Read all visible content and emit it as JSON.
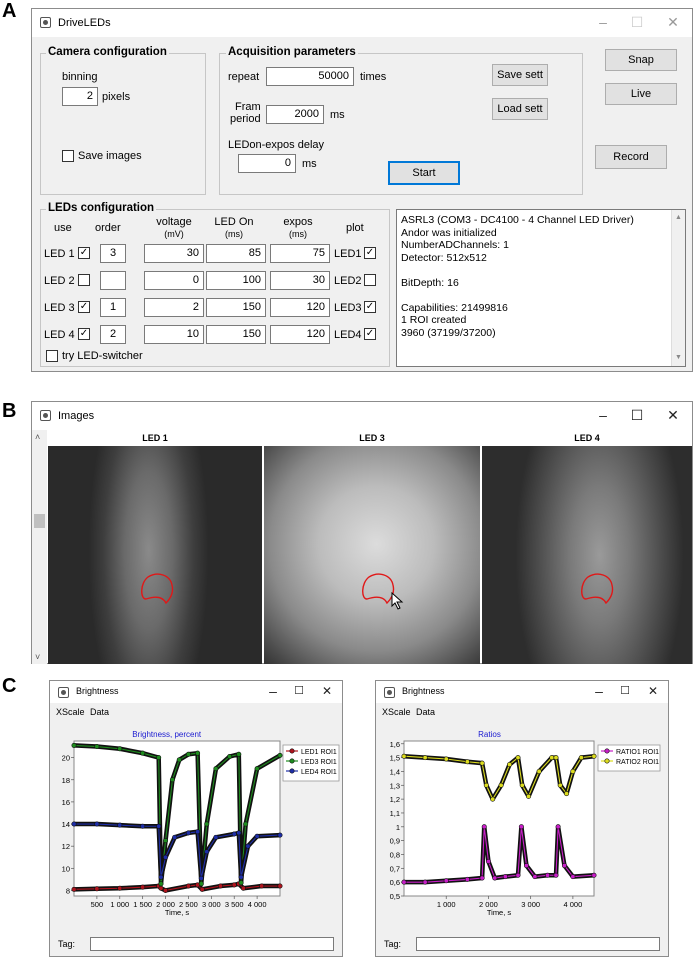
{
  "panels": {
    "a": "A",
    "b": "B",
    "c": "C"
  },
  "drive": {
    "title": "DriveLEDs",
    "camera": {
      "title": "Camera configuration",
      "binning_label": "binning",
      "binning_value": "2",
      "binning_unit": "pixels",
      "save_images": "Save images"
    },
    "acq": {
      "title": "Acquisition parameters",
      "repeat_label": "repeat",
      "repeat_value": "50000",
      "repeat_unit": "times",
      "fram_label1": "Fram",
      "fram_label2": "period",
      "fram_value": "2000",
      "fram_unit": "ms",
      "delay_label": "LEDon-expos delay",
      "delay_value": "0",
      "delay_unit": "ms",
      "save_sett": "Save sett",
      "load_sett": "Load sett",
      "start": "Start"
    },
    "side": {
      "snap": "Snap",
      "live": "Live",
      "record": "Record"
    },
    "leds": {
      "title": "LEDs configuration",
      "headers": {
        "use": "use",
        "order": "order",
        "voltage": "voltage",
        "voltage_unit": "(mV)",
        "ledon": "LED On",
        "ledon_unit": "(ms)",
        "expos": "expos",
        "expos_unit": "(ms)",
        "plot": "plot"
      },
      "rows": [
        {
          "name": "LED 1",
          "use": "✓",
          "order": "3",
          "voltage": "30",
          "ledon": "85",
          "expos": "75",
          "plot_name": "LED1",
          "plot": "✓"
        },
        {
          "name": "LED 2",
          "use": "",
          "order": "",
          "voltage": "0",
          "ledon": "100",
          "expos": "30",
          "plot_name": "LED2",
          "plot": ""
        },
        {
          "name": "LED 3",
          "use": "✓",
          "order": "1",
          "voltage": "2",
          "ledon": "150",
          "expos": "120",
          "plot_name": "LED3",
          "plot": "✓"
        },
        {
          "name": "LED 4",
          "use": "✓",
          "order": "2",
          "voltage": "10",
          "ledon": "150",
          "expos": "120",
          "plot_name": "LED4",
          "plot": "✓"
        }
      ],
      "try_switcher": "try LED-switcher"
    },
    "info_lines": [
      "ASRL3 (COM3 - DC4100 - 4 Channel LED Driver)",
      "Andor was initialized",
      "NumberADChannels: 1",
      "Detector: 512x512",
      "",
      "BitDepth: 16",
      "",
      "Capabilities: 21499816",
      "1 ROI created",
      "3960 (37199/37200)"
    ]
  },
  "images": {
    "title": "Images",
    "tiles": [
      {
        "label": "LED 1"
      },
      {
        "label": "LED 3"
      },
      {
        "label": "LED 4"
      }
    ]
  },
  "brightness_left": {
    "title": "Brightness",
    "menu": [
      "XScale",
      "Data"
    ],
    "tag_label": "Tag:",
    "chart_data": {
      "type": "line",
      "title": "Brightness, percent",
      "xlabel": "Time, s",
      "ylabel": "",
      "xlim": [
        0,
        4500
      ],
      "ylim": [
        7.5,
        21.5
      ],
      "xticks": [
        500,
        1000,
        1500,
        2000,
        2500,
        3000,
        3500,
        4000
      ],
      "xtick_labels": [
        "500",
        "1 000",
        "1 500",
        "2 000",
        "2 500",
        "3 000",
        "3 500",
        "4 000"
      ],
      "yticks": [
        8,
        10,
        12,
        14,
        16,
        18,
        20
      ],
      "legend_position": "top-right",
      "series": [
        {
          "name": "LED1 ROI1",
          "color": "#b0141e",
          "x": [
            0,
            500,
            1000,
            1500,
            1850,
            1900,
            2000,
            2500,
            2700,
            2800,
            3200,
            3500,
            3600,
            3700,
            4100,
            4500
          ],
          "y": [
            8.1,
            8.15,
            8.2,
            8.3,
            8.4,
            8.2,
            8.0,
            8.4,
            8.5,
            8.1,
            8.4,
            8.5,
            8.6,
            8.2,
            8.4,
            8.4
          ]
        },
        {
          "name": "LED3 ROI1",
          "color": "#1e8c1e",
          "x": [
            0,
            500,
            1000,
            1500,
            1850,
            1900,
            2000,
            2150,
            2300,
            2500,
            2700,
            2780,
            2900,
            3100,
            3400,
            3600,
            3650,
            3750,
            4000,
            4500
          ],
          "y": [
            21.1,
            21.0,
            20.8,
            20.4,
            20.0,
            8.6,
            12.5,
            18.0,
            19.8,
            20.3,
            20.4,
            8.6,
            14.0,
            19.0,
            20.1,
            20.3,
            8.7,
            14.0,
            19.0,
            20.2
          ]
        },
        {
          "name": "LED4 ROI1",
          "color": "#1e2ea8",
          "x": [
            0,
            500,
            1000,
            1500,
            1850,
            1900,
            2000,
            2200,
            2500,
            2700,
            2780,
            2900,
            3100,
            3500,
            3600,
            3650,
            3800,
            4000,
            4500
          ],
          "y": [
            14.0,
            14.0,
            13.9,
            13.8,
            13.8,
            9.2,
            11.0,
            12.8,
            13.2,
            13.3,
            9.1,
            11.5,
            12.8,
            13.1,
            13.2,
            9.2,
            12.0,
            12.9,
            13.0
          ]
        }
      ]
    }
  },
  "brightness_right": {
    "title": "Brightness",
    "menu": [
      "XScale",
      "Data"
    ],
    "tag_label": "Tag:",
    "chart_data": {
      "type": "line",
      "title": "Ratios",
      "xlabel": "Time, s",
      "ylabel": "",
      "xlim": [
        0,
        4500
      ],
      "ylim": [
        0.5,
        1.62
      ],
      "xticks": [
        1000,
        2000,
        3000,
        4000
      ],
      "xtick_labels": [
        "1 000",
        "2 000",
        "3 000",
        "4 000"
      ],
      "yticks": [
        0.5,
        0.6,
        0.7,
        0.8,
        0.9,
        1.0,
        1.1,
        1.2,
        1.3,
        1.4,
        1.5,
        1.6
      ],
      "ytick_labels": [
        "0,5",
        "0,6",
        "0,7",
        "0,8",
        "0,9",
        "1",
        "1,1",
        "1,2",
        "1,3",
        "1,4",
        "1,5",
        "1,6"
      ],
      "legend_position": "top-right",
      "series": [
        {
          "name": "RATIO1 ROI1",
          "color": "#c81ec8",
          "x": [
            0,
            500,
            1000,
            1500,
            1850,
            1900,
            2000,
            2150,
            2400,
            2700,
            2780,
            2900,
            3100,
            3400,
            3600,
            3650,
            3800,
            4000,
            4500
          ],
          "y": [
            0.6,
            0.6,
            0.61,
            0.62,
            0.63,
            1.0,
            0.75,
            0.63,
            0.64,
            0.65,
            1.0,
            0.72,
            0.64,
            0.65,
            0.65,
            1.0,
            0.72,
            0.64,
            0.65
          ]
        },
        {
          "name": "RATIO2 ROI1",
          "color": "#dcdc1e",
          "x": [
            0,
            500,
            1000,
            1500,
            1850,
            1950,
            2100,
            2300,
            2500,
            2700,
            2800,
            2950,
            3200,
            3500,
            3600,
            3700,
            3850,
            4000,
            4200,
            4500
          ],
          "y": [
            1.51,
            1.5,
            1.49,
            1.47,
            1.46,
            1.3,
            1.2,
            1.3,
            1.45,
            1.5,
            1.3,
            1.22,
            1.4,
            1.5,
            1.5,
            1.3,
            1.24,
            1.4,
            1.5,
            1.51
          ]
        }
      ]
    }
  }
}
